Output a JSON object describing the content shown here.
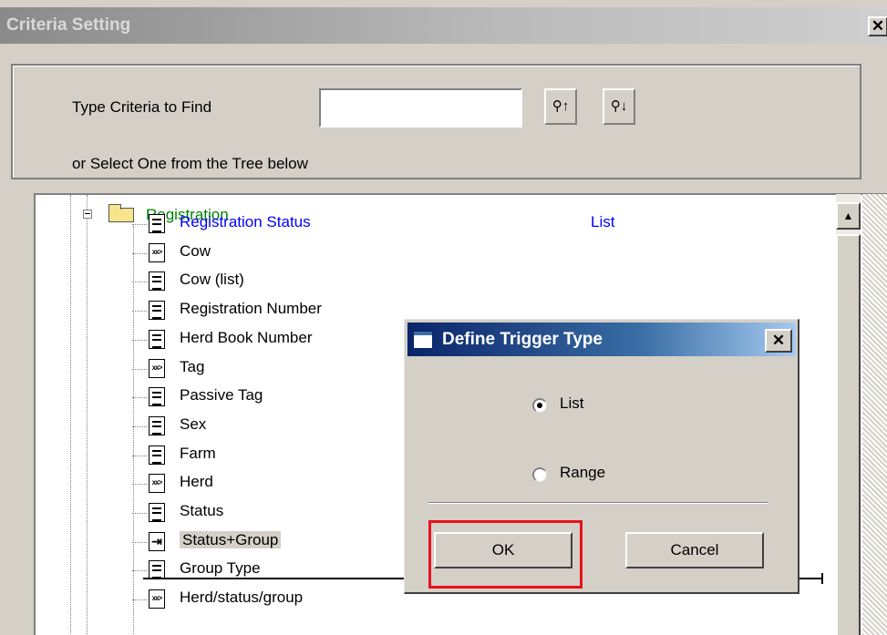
{
  "window": {
    "title": "Criteria Setting",
    "close_glyph": "✕"
  },
  "find": {
    "label": "Type Criteria to Find",
    "value": "",
    "find_up_icon": "binoculars-up-icon",
    "find_down_icon": "binoculars-down-icon",
    "hint": "or Select One from the Tree below"
  },
  "tree": {
    "folder_label": "Registration",
    "folder_color": "#008000",
    "selected_color": "#0000ff",
    "items": [
      {
        "label": "Registration Status",
        "type_label": "List",
        "icon": "document-icon"
      },
      {
        "label": "Cow",
        "icon": "xx-icon"
      },
      {
        "label": "Cow (list)",
        "icon": "document-icon"
      },
      {
        "label": "Registration Number",
        "icon": "document-icon"
      },
      {
        "label": "Herd Book Number",
        "icon": "document-icon"
      },
      {
        "label": "Tag",
        "icon": "xx-icon"
      },
      {
        "label": "Passive Tag",
        "icon": "document-icon"
      },
      {
        "label": "Sex",
        "icon": "document-icon"
      },
      {
        "label": "Farm",
        "icon": "document-icon"
      },
      {
        "label": "Herd",
        "icon": "xx-icon"
      },
      {
        "label": "Status",
        "icon": "document-icon"
      },
      {
        "label": "Status+Group",
        "icon": "link-icon"
      },
      {
        "label": "Group Type",
        "icon": "document-icon"
      },
      {
        "label": "Herd/status/group",
        "icon": "xx-icon"
      }
    ]
  },
  "dialog": {
    "title": "Define Trigger Type",
    "close_glyph": "✕",
    "options": [
      {
        "label": "List",
        "selected": true
      },
      {
        "label": "Range",
        "selected": false
      }
    ],
    "ok_label": "OK",
    "cancel_label": "Cancel",
    "highlight_color": "#e8101c"
  }
}
